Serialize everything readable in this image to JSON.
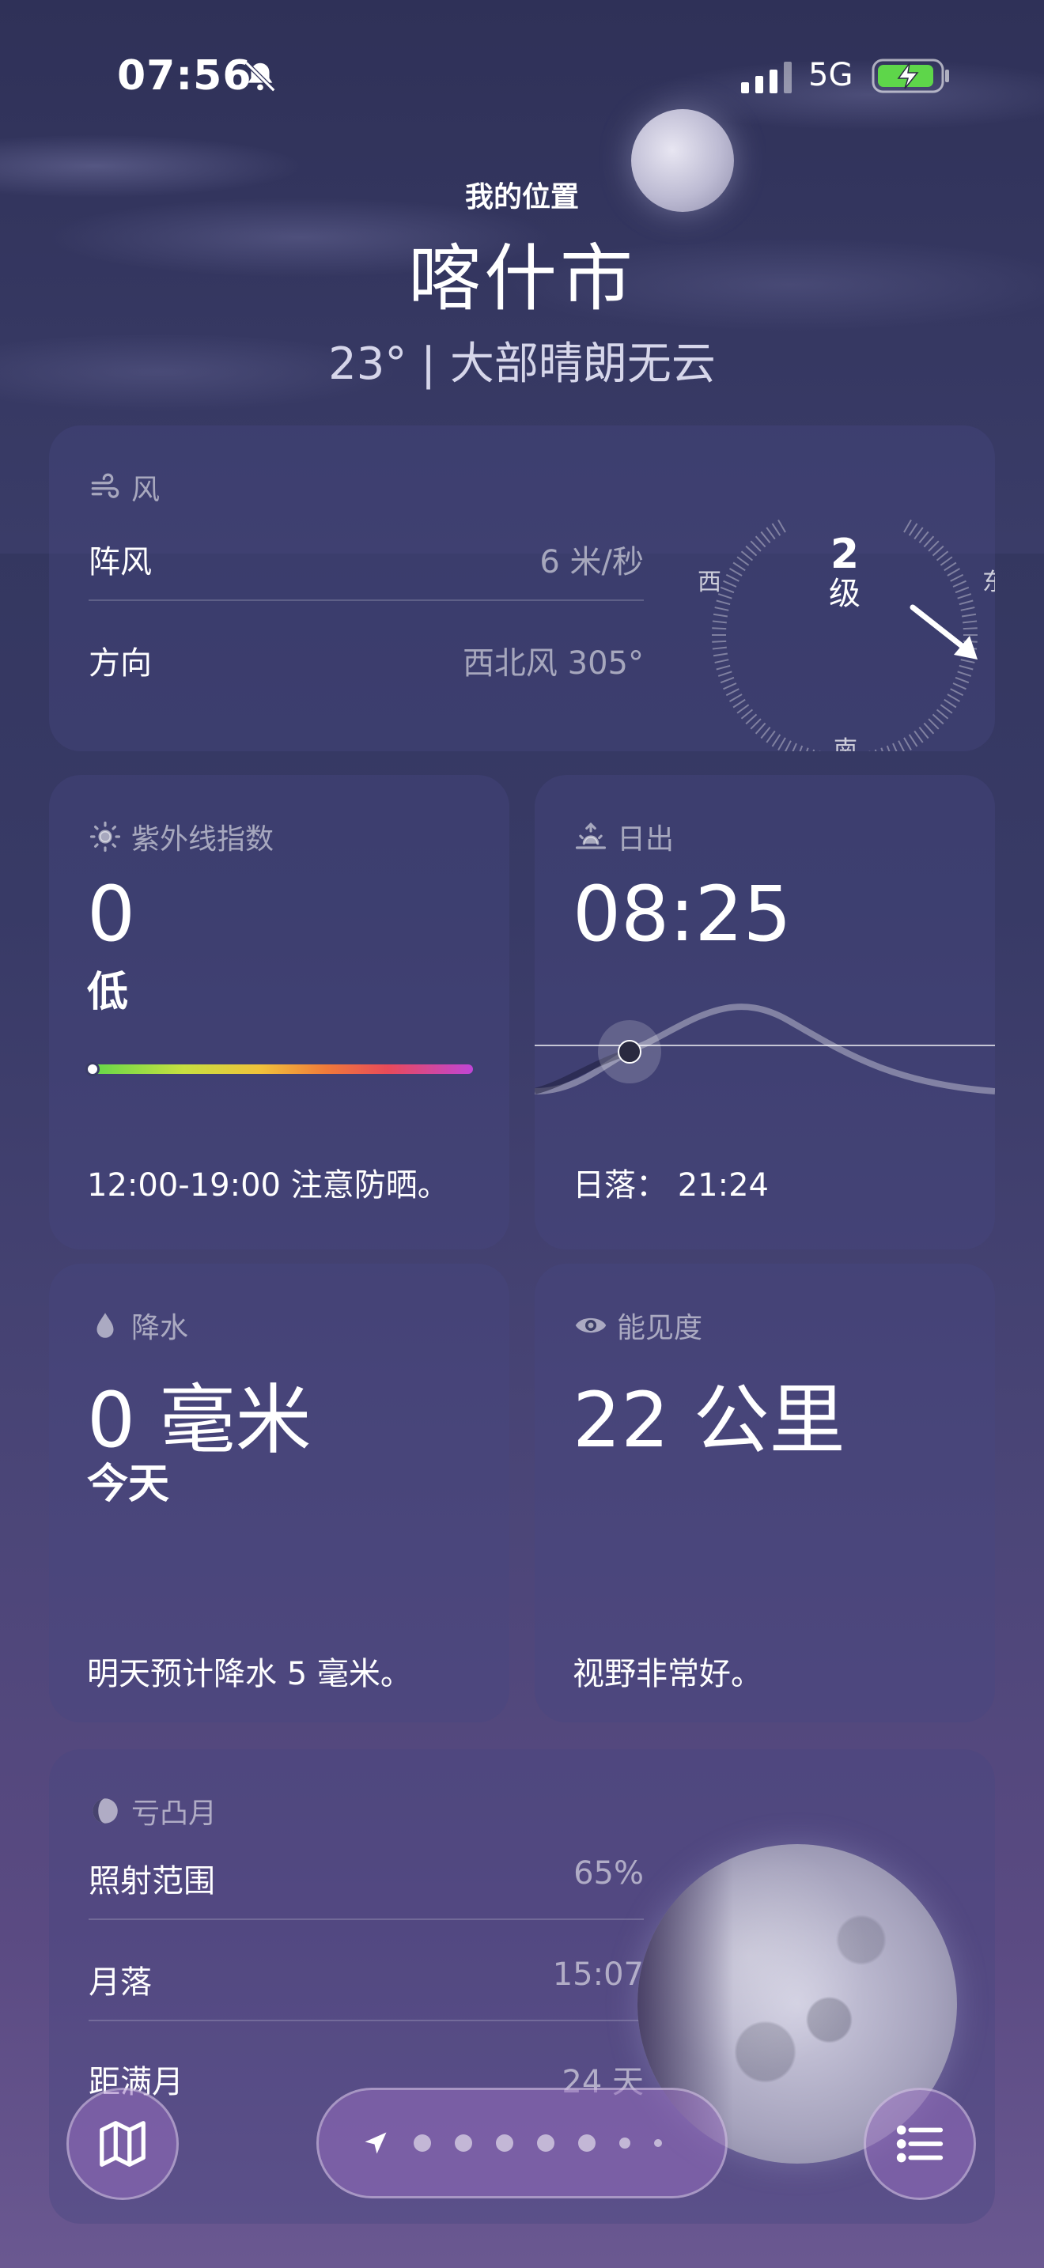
{
  "status_bar": {
    "time": "07:56",
    "network": "5G",
    "icons": [
      "bell-slash-icon",
      "signal-icon",
      "battery-charging-icon"
    ]
  },
  "header": {
    "location_label": "我的位置",
    "city": "喀什市",
    "condition": "23° | 大部晴朗无云"
  },
  "wind": {
    "title": "风",
    "gust_label": "阵风",
    "gust_value": "6 米/秒",
    "direction_label": "方向",
    "direction_value": "西北风 305°",
    "level_num": "2",
    "level_unit": "级",
    "compass": {
      "west": "西",
      "east": "东",
      "south": "南"
    },
    "direction_degrees": 305
  },
  "uv": {
    "title": "紫外线指数",
    "value": "0",
    "level": "低",
    "footer": "12:00-19:00 注意防晒。",
    "scale_fraction": 0.0
  },
  "sunrise": {
    "title": "日出",
    "time": "08:25",
    "footer": "日落： 21:24"
  },
  "precip": {
    "title": "降水",
    "value": "0 毫米",
    "period": "今天",
    "footer": "明天预计降水 5 毫米。"
  },
  "visibility": {
    "title": "能见度",
    "value": "22 公里",
    "footer": "视野非常好。"
  },
  "moon": {
    "title": "亏凸月",
    "illum_label": "照射范围",
    "illum_value": "65%",
    "moonset_label": "月落",
    "moonset_value": "15:07",
    "next_full_label": "距满月",
    "next_full_value": "24 天"
  },
  "bottom_bar": {
    "page_count": 7,
    "icons": [
      "map-icon",
      "location-arrow-icon",
      "list-icon"
    ]
  },
  "colors": {
    "background_top": "#33365e",
    "background_bottom": "#6a5891",
    "card": "rgba(70,72,130,0.38)"
  }
}
